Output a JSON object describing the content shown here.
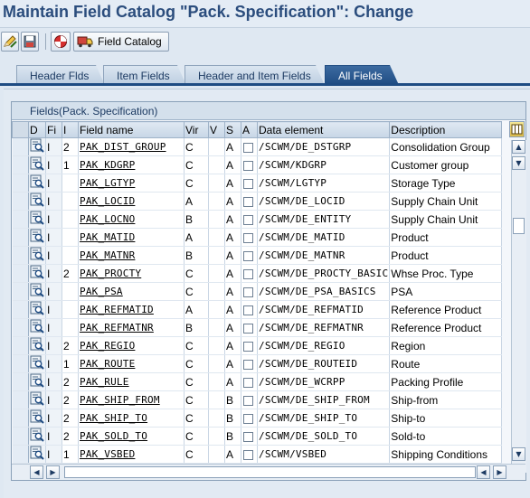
{
  "window": {
    "title": "Maintain Field Catalog \"Pack. Specification\": Change"
  },
  "toolbar": {
    "buttons": [
      {
        "icon": "display-change-icon"
      },
      {
        "icon": "save-local-icon"
      },
      {
        "icon": "transport-icon"
      }
    ],
    "field_catalog_label": "Field Catalog"
  },
  "tabs": [
    {
      "label": "Header Flds",
      "active": false
    },
    {
      "label": "Item Fields",
      "active": false
    },
    {
      "label": "Header and Item Fields",
      "active": false
    },
    {
      "label": "All Fields",
      "active": true
    }
  ],
  "grid": {
    "title": "Fields(Pack. Specification)",
    "columns": [
      "D",
      "Fi",
      "I",
      "Field name",
      "Vir",
      "V",
      "S",
      "A",
      "Data element",
      "Description"
    ],
    "rows": [
      {
        "fi": "I",
        "i": "2",
        "field": "PAK_DIST_GROUP",
        "vir": "C",
        "v": "",
        "s": "A",
        "data_element": "/SCWM/DE_DSTGRP",
        "description": "Consolidation Group"
      },
      {
        "fi": "I",
        "i": "1",
        "field": "PAK_KDGRP",
        "vir": "C",
        "v": "",
        "s": "A",
        "data_element": "/SCWM/KDGRP",
        "description": "Customer group"
      },
      {
        "fi": "I",
        "i": "",
        "field": "PAK_LGTYP",
        "vir": "C",
        "v": "",
        "s": "A",
        "data_element": "/SCWM/LGTYP",
        "description": "Storage Type"
      },
      {
        "fi": "I",
        "i": "",
        "field": "PAK_LOCID",
        "vir": "A",
        "v": "",
        "s": "A",
        "data_element": "/SCWM/DE_LOCID",
        "description": "Supply Chain Unit"
      },
      {
        "fi": "I",
        "i": "",
        "field": "PAK_LOCNO",
        "vir": "B",
        "v": "",
        "s": "A",
        "data_element": "/SCWM/DE_ENTITY",
        "description": "Supply Chain Unit"
      },
      {
        "fi": "I",
        "i": "",
        "field": "PAK_MATID",
        "vir": "A",
        "v": "",
        "s": "A",
        "data_element": "/SCWM/DE_MATID",
        "description": "Product"
      },
      {
        "fi": "I",
        "i": "",
        "field": "PAK_MATNR",
        "vir": "B",
        "v": "",
        "s": "A",
        "data_element": "/SCWM/DE_MATNR",
        "description": "Product"
      },
      {
        "fi": "I",
        "i": "2",
        "field": "PAK_PROCTY",
        "vir": "C",
        "v": "",
        "s": "A",
        "data_element": "/SCWM/DE_PROCTY_BASIC",
        "description": "Whse Proc. Type"
      },
      {
        "fi": "I",
        "i": "",
        "field": "PAK_PSA",
        "vir": "C",
        "v": "",
        "s": "A",
        "data_element": "/SCWM/DE_PSA_BASICS",
        "description": "PSA"
      },
      {
        "fi": "I",
        "i": "",
        "field": "PAK_REFMATID",
        "vir": "A",
        "v": "",
        "s": "A",
        "data_element": "/SCWM/DE_REFMATID",
        "description": "Reference Product"
      },
      {
        "fi": "I",
        "i": "",
        "field": "PAK_REFMATNR",
        "vir": "B",
        "v": "",
        "s": "A",
        "data_element": "/SCWM/DE_REFMATNR",
        "description": "Reference Product"
      },
      {
        "fi": "I",
        "i": "2",
        "field": "PAK_REGIO",
        "vir": "C",
        "v": "",
        "s": "A",
        "data_element": "/SCWM/DE_REGIO",
        "description": "Region"
      },
      {
        "fi": "I",
        "i": "1",
        "field": "PAK_ROUTE",
        "vir": "C",
        "v": "",
        "s": "A",
        "data_element": "/SCWM/DE_ROUTEID",
        "description": "Route"
      },
      {
        "fi": "I",
        "i": "2",
        "field": "PAK_RULE",
        "vir": "C",
        "v": "",
        "s": "A",
        "data_element": "/SCWM/DE_WCRPP",
        "description": "Packing Profile"
      },
      {
        "fi": "I",
        "i": "2",
        "field": "PAK_SHIP_FROM",
        "vir": "C",
        "v": "",
        "s": "B",
        "data_element": "/SCWM/DE_SHIP_FROM",
        "description": "Ship-from"
      },
      {
        "fi": "I",
        "i": "2",
        "field": "PAK_SHIP_TO",
        "vir": "C",
        "v": "",
        "s": "B",
        "data_element": "/SCWM/DE_SHIP_TO",
        "description": "Ship-to"
      },
      {
        "fi": "I",
        "i": "2",
        "field": "PAK_SOLD_TO",
        "vir": "C",
        "v": "",
        "s": "B",
        "data_element": "/SCWM/DE_SOLD_TO",
        "description": "Sold-to"
      },
      {
        "fi": "I",
        "i": "1",
        "field": "PAK_VSBED",
        "vir": "C",
        "v": "",
        "s": "A",
        "data_element": "/SCWM/VSBED",
        "description": "Shipping Conditions"
      }
    ]
  },
  "colors": {
    "title": "#2b4d7d",
    "active_tab": "#1f4c83",
    "panel": "#e2eaf3"
  }
}
